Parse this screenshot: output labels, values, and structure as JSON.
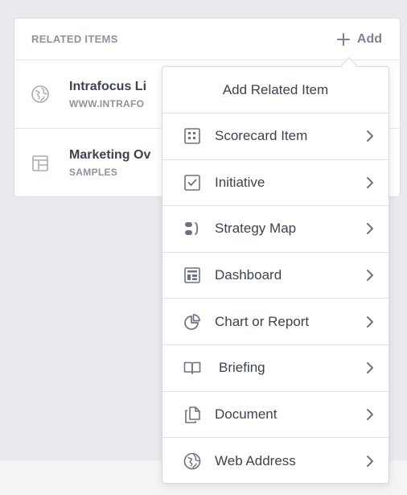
{
  "related_items": {
    "header_title": "RELATED ITEMS",
    "add_label": "Add",
    "rows": [
      {
        "title": "Intrafocus Li",
        "subtitle": "WWW.INTRAFO",
        "icon": "globe-icon"
      },
      {
        "title": "Marketing Ov",
        "subtitle": "SAMPLES",
        "icon": "dashboard-icon"
      }
    ]
  },
  "menu": {
    "title": "Add Related Item",
    "items": [
      {
        "label": "Scorecard Item",
        "icon": "scorecard-icon"
      },
      {
        "label": "Initiative",
        "icon": "checkbox-icon"
      },
      {
        "label": "Strategy Map",
        "icon": "strategy-map-icon"
      },
      {
        "label": "Dashboard",
        "icon": "dashboard-icon"
      },
      {
        "label": "Chart or Report",
        "icon": "pie-chart-icon"
      },
      {
        "label": "Briefing",
        "icon": "book-icon"
      },
      {
        "label": "Document",
        "icon": "document-icon"
      },
      {
        "label": "Web Address",
        "icon": "globe-icon"
      }
    ]
  },
  "colors": {
    "icon_gray": "#7d8490",
    "text_dark": "#3d434d",
    "text_muted": "#8e939c"
  }
}
